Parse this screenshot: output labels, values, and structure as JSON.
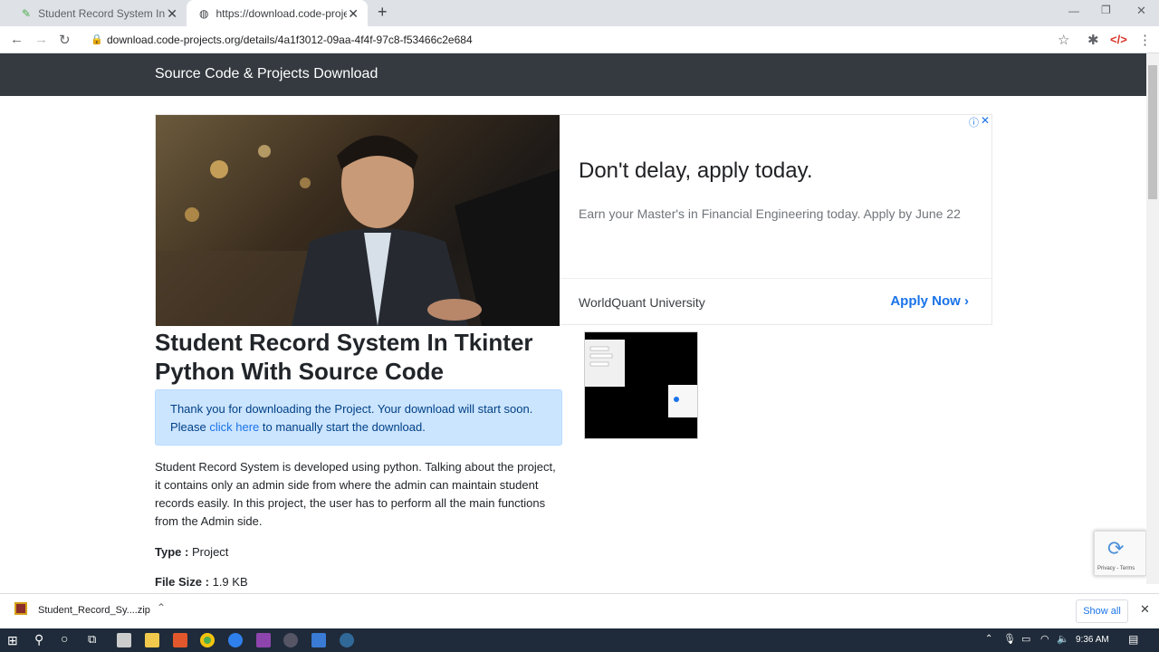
{
  "browser": {
    "tabs": [
      {
        "label": "Student Record System In Tkinter"
      },
      {
        "label": "https://download.code-projects.o"
      }
    ],
    "new_tab_label": "+",
    "url": "download.code-projects.org/details/4a1f3012-09aa-4f4f-97c8-f53466c2e684"
  },
  "site": {
    "brand": "Source Code & Projects Download"
  },
  "ad": {
    "headline": "Don't delay, apply today.",
    "body": "Earn your Master's in Financial Engineering today. Apply by June 22",
    "advertiser": "WorldQuant University",
    "cta": "Apply Now"
  },
  "article": {
    "title": "Student Record System In Tkinter Python With Source Code",
    "alert_text": "Thank you for downloading the Project. Your download will start soon. Please",
    "alert_link": "click here",
    "alert_tail": "to manually start the download.",
    "description": "Student Record System is developed using python. Talking about the project, it contains only an admin side from where the admin can maintain student records easily. In this project, the user has to perform all the main functions from the Admin side.",
    "type_label": "Type :",
    "type_value": "Project",
    "size_label": "File Size :",
    "size_value": "1.9 KB"
  },
  "recaptcha": {
    "text": "Privacy - Terms"
  },
  "downloads": {
    "file": "Student_Record_Sy....zip",
    "show_all": "Show all"
  },
  "taskbar": {
    "clock": "9:36 AM"
  },
  "colors": {
    "navbar": "#343a40",
    "alert_bg": "#cce5ff",
    "link": "#1a73e8"
  }
}
